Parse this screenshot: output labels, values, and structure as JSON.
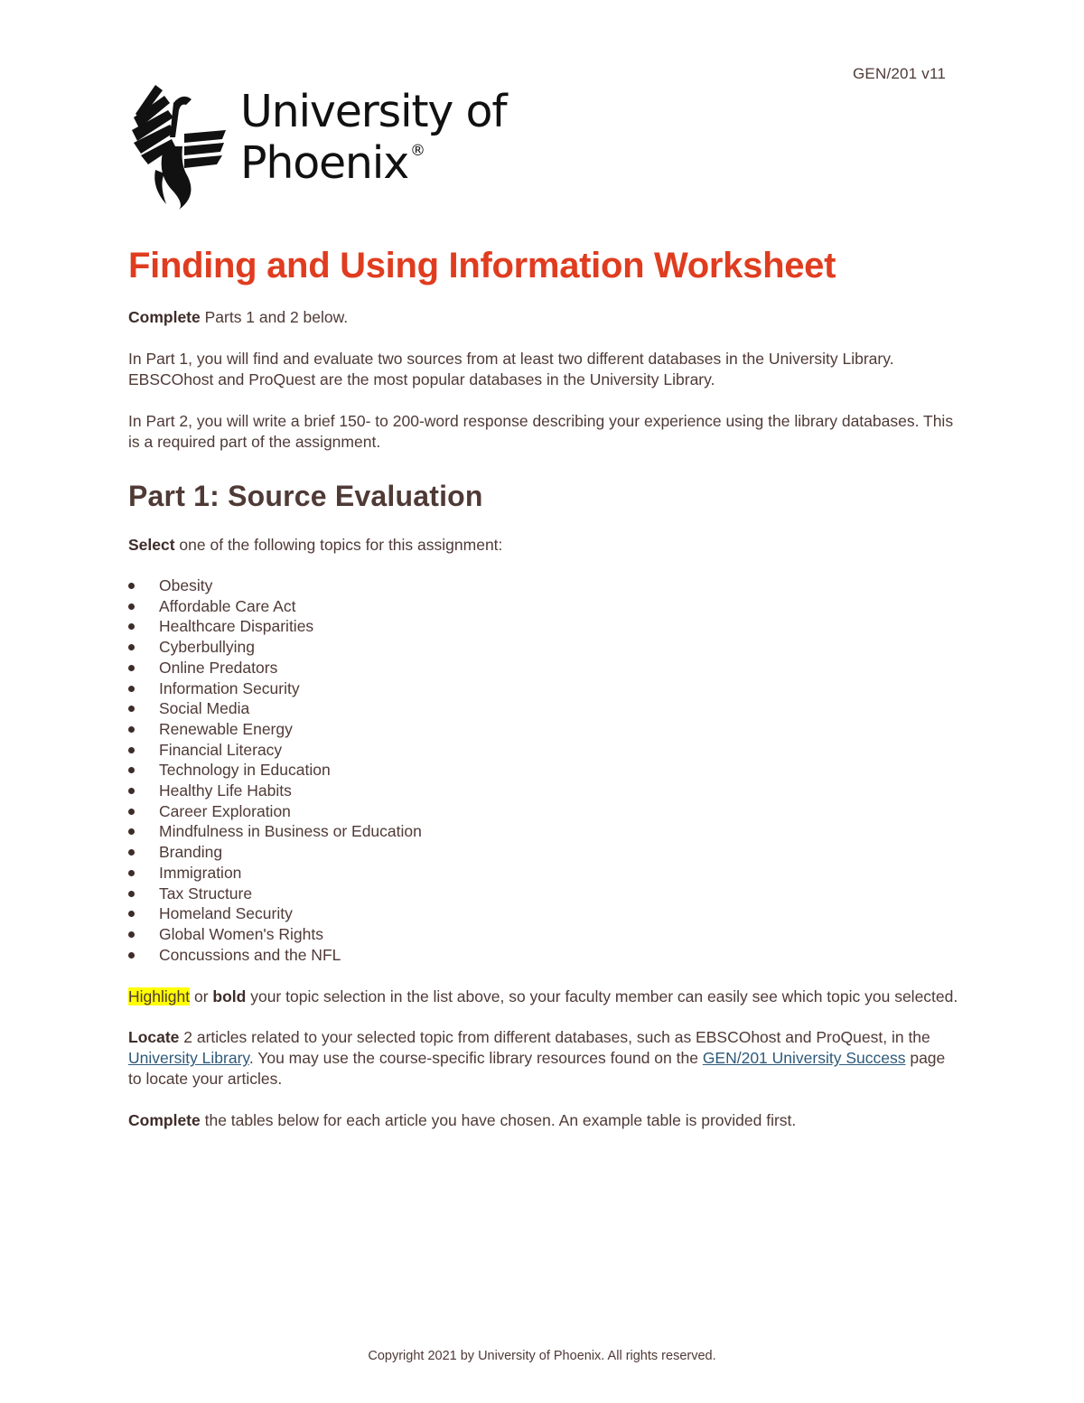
{
  "header": {
    "version": "GEN/201 v11",
    "logo_text": "University of Phoenix",
    "logo_mark": "®",
    "logo_icon": "phoenix-bird-icon"
  },
  "document": {
    "title": "Finding and Using Information Worksheet",
    "intro": {
      "complete_bold": "Complete",
      "complete_rest": " Parts 1 and 2 below.",
      "part1_text": "In Part 1, you will find and evaluate two sources from at least two different databases in the University Library. EBSCOhost and ProQuest are the most popular databases in the University Library.",
      "part2_text": "In Part 2, you will write a brief 150- to 200-word response describing your experience using the library databases. This is a required part of the assignment."
    },
    "part1": {
      "heading": "Part 1: Source Evaluation",
      "select_bold": "Select",
      "select_rest": " one of the following topics for this assignment:",
      "topics": [
        "Obesity",
        "Affordable Care Act",
        "Healthcare Disparities",
        "Cyberbullying",
        "Online Predators",
        "Information Security",
        "Social Media",
        "Renewable Energy",
        "Financial Literacy",
        "Technology in Education",
        "Healthy Life Habits",
        "Career Exploration",
        "Mindfulness in Business or Education",
        "Branding",
        "Immigration",
        "Tax Structure",
        "Homeland Security",
        "Global Women's Rights",
        "Concussions and the NFL"
      ],
      "highlight_word": "Highlight",
      "highlight_or": " or ",
      "highlight_bold": "bold",
      "highlight_rest": " your topic selection in the list above, so your faculty member can easily see which topic you selected.",
      "locate_bold": "Locate",
      "locate_text1": " 2 articles related to your selected topic from different databases, such as EBSCOhost and ProQuest, in the ",
      "locate_link1": "University Library",
      "locate_text2": ". You may use the course-specific library resources found on the ",
      "locate_link2": "GEN/201 University Success",
      "locate_text3": " page to locate your articles.",
      "complete_bold": "Complete",
      "complete_rest": " the tables below for each article you have chosen. An example table is provided first."
    }
  },
  "colors": {
    "title": "#e03c1f",
    "text": "#4f3a36",
    "link": "#2e5a7a",
    "highlight": "#ffff00"
  },
  "footer": {
    "copyright": "Copyright 2021 by University of Phoenix. All rights reserved."
  }
}
